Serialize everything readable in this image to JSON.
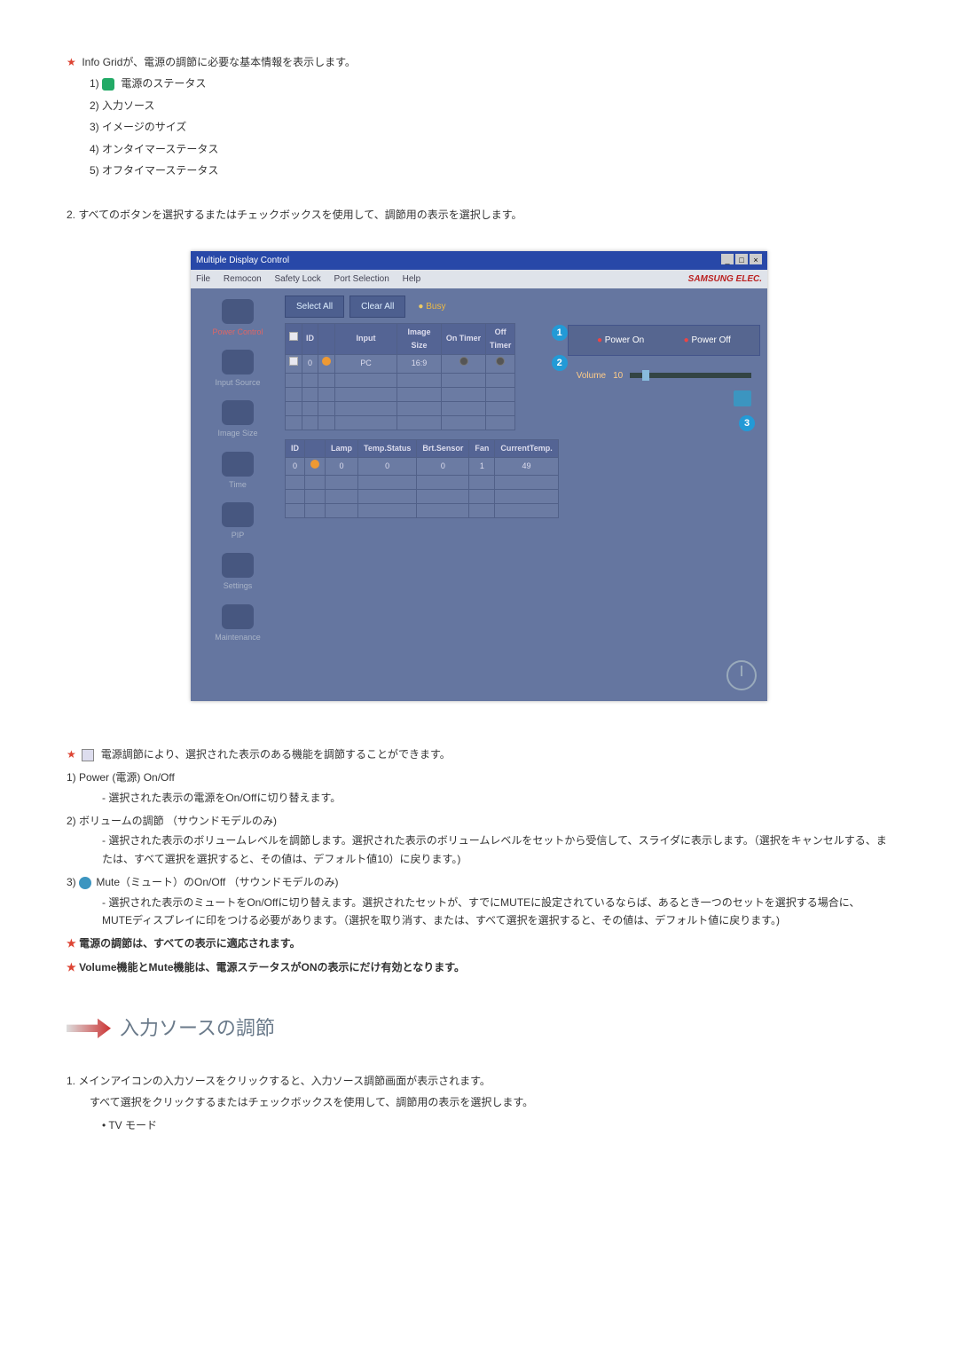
{
  "intro_star_line": "Info Gridが、電源の調節に必要な基本情報を表示します。",
  "intro_items": [
    "電源のステータス",
    "入力ソース",
    "イメージのサイズ",
    "オンタイマーステータス",
    "オフタイマーステータス"
  ],
  "step2": "すべてのボタンを選択するまたはチェックボックスを使用して、調節用の表示を選択します。",
  "app": {
    "title": "Multiple Display Control",
    "menu": [
      "File",
      "Remocon",
      "Safety Lock",
      "Port Selection",
      "Help"
    ],
    "brand": "SAMSUNG ELEC.",
    "btn_select_all": "Select All",
    "btn_clear_all": "Clear All",
    "busy": "Busy",
    "sidebar": [
      "Power Control",
      "Input Source",
      "Image Size",
      "Time",
      "PIP",
      "Settings",
      "Maintenance"
    ],
    "tbl1_head": [
      "",
      "ID",
      "",
      "Input",
      "Image Size",
      "On Timer",
      "Off Timer"
    ],
    "tbl1_row": {
      "id": "0",
      "input": "PC",
      "size": "16:9"
    },
    "tbl2_head": [
      "ID",
      "",
      "Lamp",
      "Temp.Status",
      "Brt.Sensor",
      "Fan",
      "CurrentTemp."
    ],
    "tbl2_row": {
      "id": "0",
      "lamp": "0",
      "temp": "0",
      "brt": "0",
      "fan": "1",
      "ct": "49"
    },
    "power_on": "Power On",
    "power_off": "Power Off",
    "volume_label": "Volume",
    "volume_value": "10"
  },
  "callouts": {
    "c1": "1",
    "c2": "2",
    "c3": "3"
  },
  "after_img_star": "電源調節により、選択された表示のある機能を調節することができます。",
  "item1_title": "Power (電源) On/Off",
  "item1_body": "選択された表示の電源をOn/Offに切り替えます。",
  "item2_title": "ボリュームの調節 （サウンドモデルのみ)",
  "item2_body": "選択された表示のボリュームレベルを調節します。選択された表示のボリュームレベルをセットから受信して、スライダに表示します。（選択をキャンセルする、または、すべて選択を選択すると、その値は、デフォルト値10）に戻ります。)",
  "item3_title": "Mute（ミュート）のOn/Off （サウンドモデルのみ)",
  "item3_body": "選択された表示のミュートをOn/Offに切り替えます。選択されたセットが、すでにMUTEに設定されているならば、あるとき一つのセットを選択する場合に、 MUTEディスプレイに印をつける必要があります。（選択を取り消す、または、すべて選択を選択すると、その値は、デフォルト値に戻ります。)",
  "note1": "電源の調節は、すべての表示に適応されます。",
  "note2": "Volume機能とMute機能は、電源ステータスがONの表示にだけ有効となります。",
  "section2_title": "入力ソースの調節",
  "sec2_step1_l1": "メインアイコンの入力ソースをクリックすると、入力ソース調節画面が表示されます。",
  "sec2_step1_l2": "すべて選択をクリックするまたはチェックボックスを使用して、調節用の表示を選択します。",
  "sec2_bullet": "TV モード"
}
